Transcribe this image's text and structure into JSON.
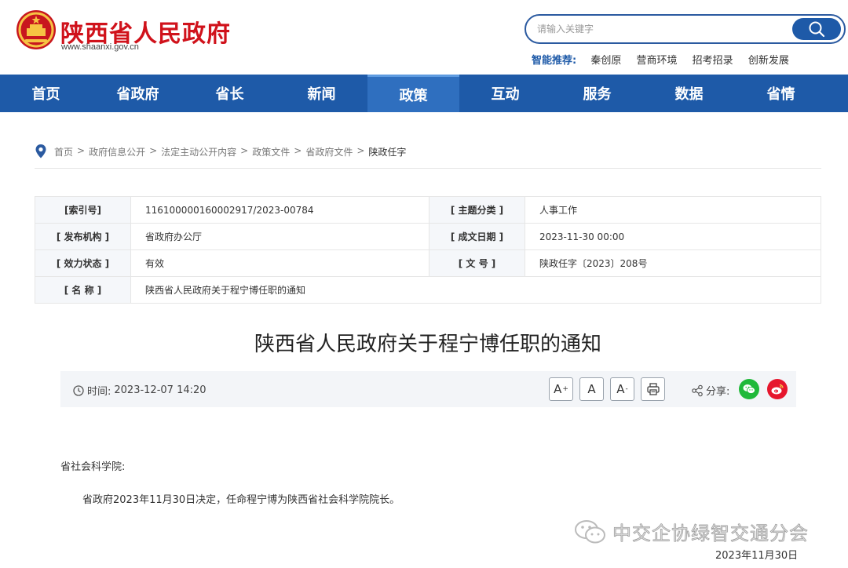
{
  "header": {
    "site_name": "陕西省人民政府",
    "site_url": "www.shaanxi.gov.cn",
    "search_placeholder": "请输入关键字",
    "recommend_label": "智能推荐:",
    "recommend": [
      "秦创原",
      "营商环境",
      "招考招录",
      "创新发展"
    ]
  },
  "nav": {
    "items": [
      "首页",
      "省政府",
      "省长",
      "新闻",
      "政策",
      "互动",
      "服务",
      "数据",
      "省情"
    ],
    "active": "政策"
  },
  "breadcrumb": [
    "首页",
    "政府信息公开",
    "法定主动公开内容",
    "政策文件",
    "省政府文件",
    "陕政任字"
  ],
  "info": {
    "index_label": "[索引号]",
    "index_value": "116100000160002917/2023-00784",
    "topic_label": "[ 主题分类 ]",
    "topic_value": "人事工作",
    "publisher_label": "[ 发布机构 ]",
    "publisher_value": "省政府办公厅",
    "date_label": "[ 成文日期 ]",
    "date_value": "2023-11-30 00:00",
    "status_label": "[ 效力状态 ]",
    "status_value": "有效",
    "docno_label": "[ 文 号 ]",
    "docno_value": "陕政任字〔2023〕208号",
    "name_label": "[ 名 称 ]",
    "name_value": "陕西省人民政府关于程宁博任职的通知"
  },
  "article": {
    "title": "陕西省人民政府关于程宁博任职的通知",
    "time_label": "时间:",
    "time_value": "2023-12-07 14:20",
    "font_larger": "A",
    "font_normal": "A",
    "font_smaller": "A",
    "larger_mark": "+",
    "smaller_mark": "-",
    "share_label": "分享:",
    "salutation": "省社会科学院:",
    "body": "省政府2023年11月30日决定，任命程宁博为陕西省社会科学院院长。",
    "sign_date": "2023年11月30日"
  },
  "watermark": {
    "text": "中交企协绿智交通分会"
  },
  "colors": {
    "brand_red": "#d0121b",
    "nav_blue": "#1e5aa8",
    "wechat_green": "#20b93a",
    "weibo_red": "#e6162d"
  }
}
